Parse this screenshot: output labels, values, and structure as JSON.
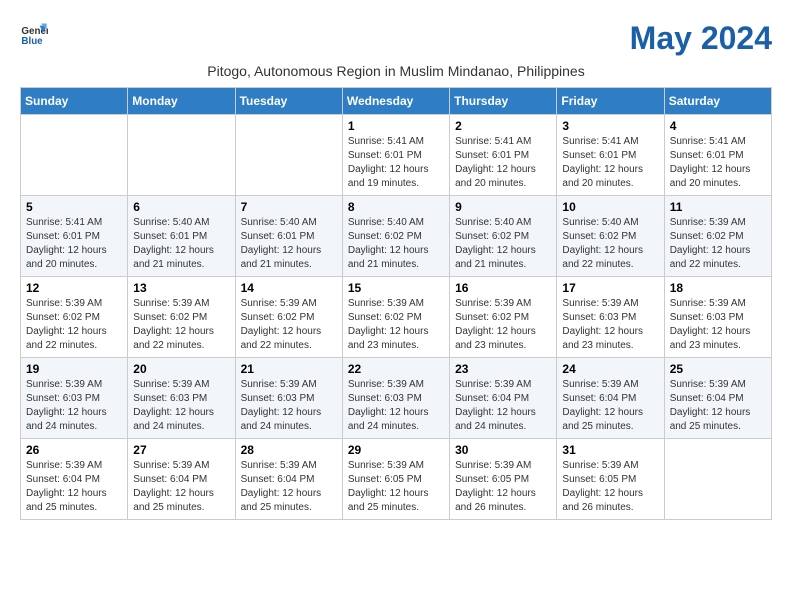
{
  "header": {
    "logo_line1": "General",
    "logo_line2": "Blue",
    "month_title": "May 2024",
    "subtitle": "Pitogo, Autonomous Region in Muslim Mindanao, Philippines"
  },
  "days_of_week": [
    "Sunday",
    "Monday",
    "Tuesday",
    "Wednesday",
    "Thursday",
    "Friday",
    "Saturday"
  ],
  "weeks": [
    [
      {
        "day": "",
        "info": ""
      },
      {
        "day": "",
        "info": ""
      },
      {
        "day": "",
        "info": ""
      },
      {
        "day": "1",
        "info": "Sunrise: 5:41 AM\nSunset: 6:01 PM\nDaylight: 12 hours and 19 minutes."
      },
      {
        "day": "2",
        "info": "Sunrise: 5:41 AM\nSunset: 6:01 PM\nDaylight: 12 hours and 20 minutes."
      },
      {
        "day": "3",
        "info": "Sunrise: 5:41 AM\nSunset: 6:01 PM\nDaylight: 12 hours and 20 minutes."
      },
      {
        "day": "4",
        "info": "Sunrise: 5:41 AM\nSunset: 6:01 PM\nDaylight: 12 hours and 20 minutes."
      }
    ],
    [
      {
        "day": "5",
        "info": "Sunrise: 5:41 AM\nSunset: 6:01 PM\nDaylight: 12 hours and 20 minutes."
      },
      {
        "day": "6",
        "info": "Sunrise: 5:40 AM\nSunset: 6:01 PM\nDaylight: 12 hours and 21 minutes."
      },
      {
        "day": "7",
        "info": "Sunrise: 5:40 AM\nSunset: 6:01 PM\nDaylight: 12 hours and 21 minutes."
      },
      {
        "day": "8",
        "info": "Sunrise: 5:40 AM\nSunset: 6:02 PM\nDaylight: 12 hours and 21 minutes."
      },
      {
        "day": "9",
        "info": "Sunrise: 5:40 AM\nSunset: 6:02 PM\nDaylight: 12 hours and 21 minutes."
      },
      {
        "day": "10",
        "info": "Sunrise: 5:40 AM\nSunset: 6:02 PM\nDaylight: 12 hours and 22 minutes."
      },
      {
        "day": "11",
        "info": "Sunrise: 5:39 AM\nSunset: 6:02 PM\nDaylight: 12 hours and 22 minutes."
      }
    ],
    [
      {
        "day": "12",
        "info": "Sunrise: 5:39 AM\nSunset: 6:02 PM\nDaylight: 12 hours and 22 minutes."
      },
      {
        "day": "13",
        "info": "Sunrise: 5:39 AM\nSunset: 6:02 PM\nDaylight: 12 hours and 22 minutes."
      },
      {
        "day": "14",
        "info": "Sunrise: 5:39 AM\nSunset: 6:02 PM\nDaylight: 12 hours and 22 minutes."
      },
      {
        "day": "15",
        "info": "Sunrise: 5:39 AM\nSunset: 6:02 PM\nDaylight: 12 hours and 23 minutes."
      },
      {
        "day": "16",
        "info": "Sunrise: 5:39 AM\nSunset: 6:02 PM\nDaylight: 12 hours and 23 minutes."
      },
      {
        "day": "17",
        "info": "Sunrise: 5:39 AM\nSunset: 6:03 PM\nDaylight: 12 hours and 23 minutes."
      },
      {
        "day": "18",
        "info": "Sunrise: 5:39 AM\nSunset: 6:03 PM\nDaylight: 12 hours and 23 minutes."
      }
    ],
    [
      {
        "day": "19",
        "info": "Sunrise: 5:39 AM\nSunset: 6:03 PM\nDaylight: 12 hours and 24 minutes."
      },
      {
        "day": "20",
        "info": "Sunrise: 5:39 AM\nSunset: 6:03 PM\nDaylight: 12 hours and 24 minutes."
      },
      {
        "day": "21",
        "info": "Sunrise: 5:39 AM\nSunset: 6:03 PM\nDaylight: 12 hours and 24 minutes."
      },
      {
        "day": "22",
        "info": "Sunrise: 5:39 AM\nSunset: 6:03 PM\nDaylight: 12 hours and 24 minutes."
      },
      {
        "day": "23",
        "info": "Sunrise: 5:39 AM\nSunset: 6:04 PM\nDaylight: 12 hours and 24 minutes."
      },
      {
        "day": "24",
        "info": "Sunrise: 5:39 AM\nSunset: 6:04 PM\nDaylight: 12 hours and 25 minutes."
      },
      {
        "day": "25",
        "info": "Sunrise: 5:39 AM\nSunset: 6:04 PM\nDaylight: 12 hours and 25 minutes."
      }
    ],
    [
      {
        "day": "26",
        "info": "Sunrise: 5:39 AM\nSunset: 6:04 PM\nDaylight: 12 hours and 25 minutes."
      },
      {
        "day": "27",
        "info": "Sunrise: 5:39 AM\nSunset: 6:04 PM\nDaylight: 12 hours and 25 minutes."
      },
      {
        "day": "28",
        "info": "Sunrise: 5:39 AM\nSunset: 6:04 PM\nDaylight: 12 hours and 25 minutes."
      },
      {
        "day": "29",
        "info": "Sunrise: 5:39 AM\nSunset: 6:05 PM\nDaylight: 12 hours and 25 minutes."
      },
      {
        "day": "30",
        "info": "Sunrise: 5:39 AM\nSunset: 6:05 PM\nDaylight: 12 hours and 26 minutes."
      },
      {
        "day": "31",
        "info": "Sunrise: 5:39 AM\nSunset: 6:05 PM\nDaylight: 12 hours and 26 minutes."
      },
      {
        "day": "",
        "info": ""
      }
    ]
  ]
}
